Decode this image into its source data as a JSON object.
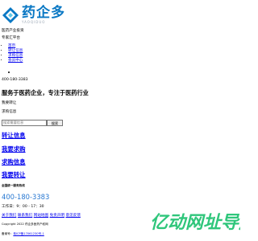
{
  "brand": {
    "title": "药企多",
    "subtitle": "YAOQIDUO"
  },
  "top_lines": {
    "tagline": "医药产业投资",
    "secondary": "专家汇平台"
  },
  "nav": {
    "items": [
      "首页",
      "转让信息",
      "求购信息",
      "会员中心"
    ]
  },
  "contact": {
    "hotline_small": "400-180-3383",
    "hotline": "400-180-3383",
    "hours": "工作日：9：00 - 17：30",
    "section_label": "全国统一服务热线"
  },
  "hero": {
    "heading": "服务于医药企业，专注于医药行业",
    "line1": "我要转让",
    "line2": "求购信息"
  },
  "search": {
    "placeholder": "搜索需要信息",
    "button": "搜索"
  },
  "quick_links": [
    "转让信息",
    "我要求购",
    "求购信息",
    "我要转让"
  ],
  "footer": {
    "links": [
      "关于我们",
      "联系我们",
      "网站地图",
      "免责声明",
      "意见反馈"
    ],
    "copyright": "Copyright 2022 药企多医药产权网",
    "icp_prefix": "备案号：",
    "icp": "粤ICP备17061230号-1"
  },
  "watermark": {
    "text": "亿动网址导航"
  },
  "colors": {
    "brand_blue": "#0a78c4",
    "link": "#0000ee",
    "phone": "#2878d2",
    "watermark_green": "#2fc67b"
  }
}
